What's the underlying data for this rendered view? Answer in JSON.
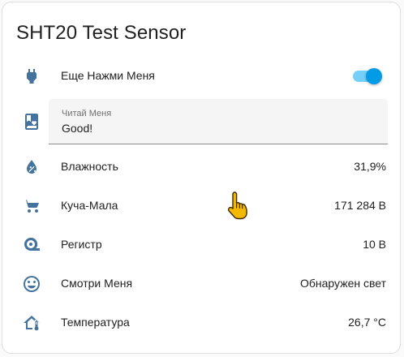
{
  "card": {
    "title": "SHT20 Test Sensor"
  },
  "rows": [
    {
      "icon": "power-plug-icon",
      "label": "Еще Нажми Меня",
      "control": "toggle",
      "state": "on"
    },
    {
      "icon": "bookmark-heart-icon",
      "control": "text",
      "field_label": "Читай Меня",
      "field_value": "Good!"
    },
    {
      "icon": "water-percent-icon",
      "label": "Влажность",
      "value": "31,9%"
    },
    {
      "icon": "cart-icon",
      "label": "Куча-Мала",
      "value": "171 284 В"
    },
    {
      "icon": "tape-measure-icon",
      "label": "Регистр",
      "value": "10 В"
    },
    {
      "icon": "emoticon-icon",
      "label": "Смотри Меня",
      "value": "Обнаружен свет"
    },
    {
      "icon": "home-thermometer-icon",
      "label": "Температура",
      "value": "26,7 °C"
    }
  ],
  "colors": {
    "accent": "#03a9f4",
    "icon": "#44739e",
    "cursor": "#f5b800"
  }
}
